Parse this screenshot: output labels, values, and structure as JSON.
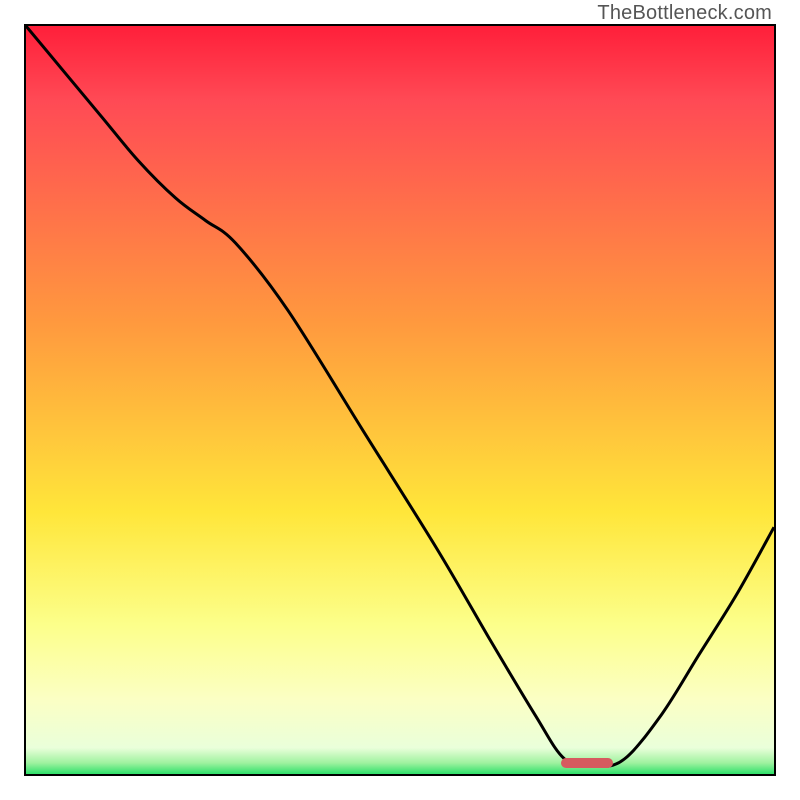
{
  "watermark": "TheBottleneck.com",
  "colors": {
    "red": "#ff1f3a",
    "pink": "#ff4a55",
    "orange": "#ff9a3e",
    "yellow": "#ffe63a",
    "lightyellow": "#fcff8a",
    "paleyellow": "#fbffc4",
    "green": "#2fe06a",
    "marker": "#d65a5f",
    "curve": "#000000"
  },
  "marker": {
    "x_frac": 0.75,
    "width_frac": 0.07,
    "y_frac": 0.985
  },
  "chart_data": {
    "type": "line",
    "title": "",
    "xlabel": "",
    "ylabel": "",
    "xlim": [
      0,
      1
    ],
    "ylim": [
      0,
      1
    ],
    "grid": false,
    "legend": null,
    "series": [
      {
        "name": "bottleneck-curve",
        "x": [
          0.0,
          0.05,
          0.1,
          0.15,
          0.2,
          0.24,
          0.28,
          0.35,
          0.45,
          0.55,
          0.62,
          0.68,
          0.72,
          0.76,
          0.8,
          0.85,
          0.9,
          0.95,
          1.0
        ],
        "y": [
          1.0,
          0.94,
          0.88,
          0.82,
          0.77,
          0.74,
          0.71,
          0.62,
          0.46,
          0.3,
          0.18,
          0.08,
          0.02,
          0.01,
          0.02,
          0.08,
          0.16,
          0.24,
          0.33
        ]
      }
    ],
    "gradient_stops": [
      {
        "pos": 0.0,
        "color": "#ff1f3a"
      },
      {
        "pos": 0.1,
        "color": "#ff4a55"
      },
      {
        "pos": 0.4,
        "color": "#ff9a3e"
      },
      {
        "pos": 0.65,
        "color": "#ffe63a"
      },
      {
        "pos": 0.8,
        "color": "#fcff8a"
      },
      {
        "pos": 0.9,
        "color": "#fbffc4"
      },
      {
        "pos": 0.965,
        "color": "#eaffda"
      },
      {
        "pos": 0.985,
        "color": "#a0f2a0"
      },
      {
        "pos": 1.0,
        "color": "#2fe06a"
      }
    ]
  }
}
